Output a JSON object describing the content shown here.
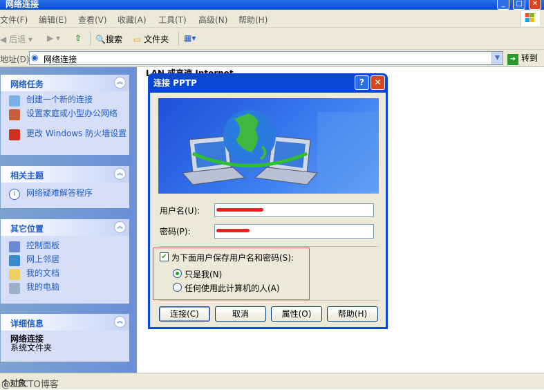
{
  "window": {
    "title": "网络连接"
  },
  "menu": [
    "文件(F)",
    "编辑(E)",
    "查看(V)",
    "收藏(A)",
    "工具(T)",
    "高级(N)",
    "帮助(H)"
  ],
  "toolbar": {
    "back": "后退",
    "search": "搜索",
    "folders": "文件夹"
  },
  "address": {
    "label": "地址(D)",
    "value": "网络连接",
    "go": "转到"
  },
  "sidebar": {
    "network_tasks": {
      "title": "网络任务",
      "items": [
        "创建一个新的连接",
        "设置家庭或小型办公网络",
        "更改 Windows 防火墙设置"
      ]
    },
    "related": {
      "title": "相关主题",
      "items": [
        "网络疑难解答程序"
      ]
    },
    "other": {
      "title": "其它位置",
      "items": [
        "控制面板",
        "网上邻居",
        "我的文档",
        "我的电脑"
      ]
    },
    "details": {
      "title": "详细信息",
      "name": "网络连接",
      "desc": "系统文件夹"
    }
  },
  "main": {
    "group_header": "LAN 或高速 Internet"
  },
  "dialog": {
    "title": "连接 PPTP",
    "username_label": "用户名(U):",
    "password_label": "密码(P):",
    "save_label": "为下面用户保存用户名和密码(S):",
    "only_me": "只是我(N)",
    "anyone": "任何使用此计算机的人(A)",
    "connect": "连接(C)",
    "cancel": "取消",
    "properties": "属性(O)",
    "help": "帮助(H)"
  },
  "status": {
    "text": "个对象",
    "watermark": "@51CTO博客"
  }
}
